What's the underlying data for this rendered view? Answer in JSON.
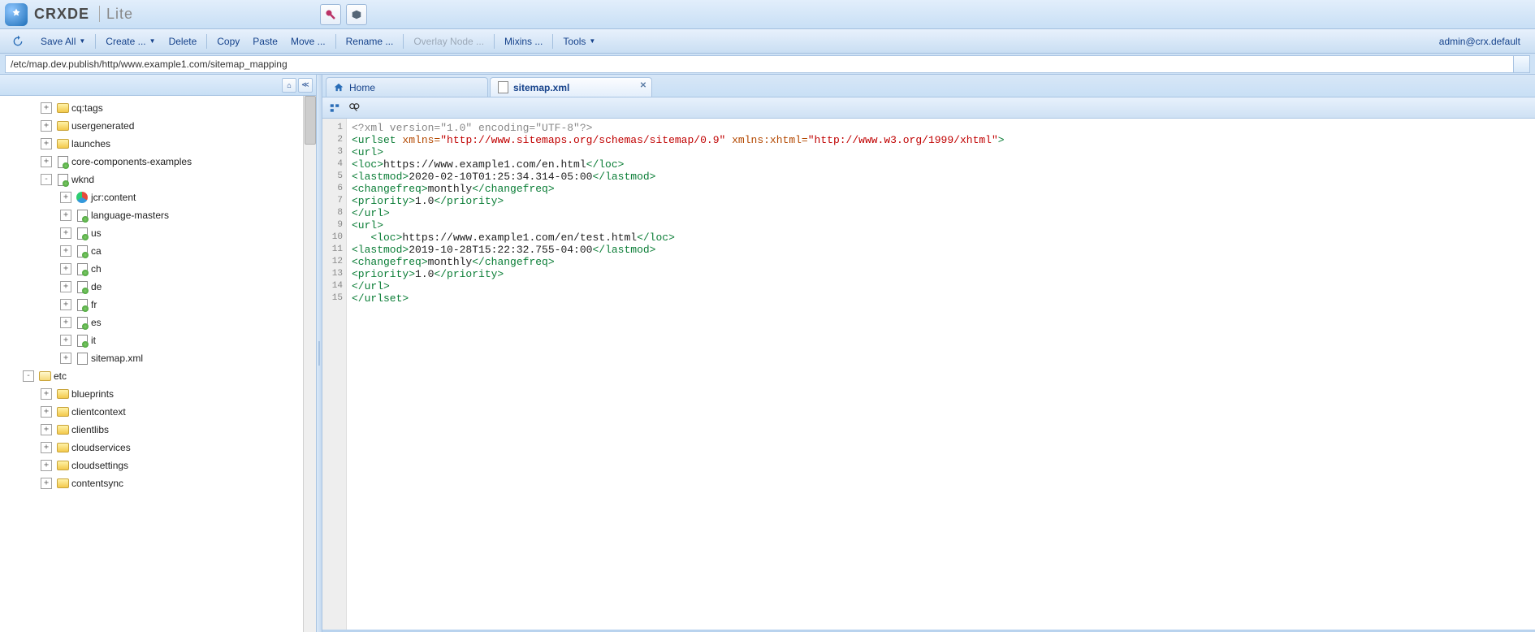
{
  "brand": {
    "name": "CRXDE",
    "suffix": "Lite"
  },
  "toolbar": {
    "save_all": "Save All",
    "create": "Create ...",
    "delete": "Delete",
    "copy": "Copy",
    "paste": "Paste",
    "move": "Move ...",
    "rename": "Rename ...",
    "overlay": "Overlay Node ...",
    "mixins": "Mixins ...",
    "tools": "Tools"
  },
  "user": "admin@crx.default",
  "path": "/etc/map.dev.publish/http/www.example1.com/sitemap_mapping",
  "tree": [
    {
      "indent": 48,
      "toggle": "+",
      "icon": "folder",
      "label": "cq:tags"
    },
    {
      "indent": 48,
      "toggle": "+",
      "icon": "folder",
      "label": "usergenerated"
    },
    {
      "indent": 48,
      "toggle": "+",
      "icon": "folder",
      "label": "launches"
    },
    {
      "indent": 48,
      "toggle": "+",
      "icon": "page",
      "label": "core-components-examples"
    },
    {
      "indent": 48,
      "toggle": "-",
      "icon": "page",
      "label": "wknd"
    },
    {
      "indent": 72,
      "toggle": "+",
      "icon": "jcr",
      "label": "jcr:content"
    },
    {
      "indent": 72,
      "toggle": "+",
      "icon": "page",
      "label": "language-masters"
    },
    {
      "indent": 72,
      "toggle": "+",
      "icon": "page",
      "label": "us"
    },
    {
      "indent": 72,
      "toggle": "+",
      "icon": "page",
      "label": "ca"
    },
    {
      "indent": 72,
      "toggle": "+",
      "icon": "page",
      "label": "ch"
    },
    {
      "indent": 72,
      "toggle": "+",
      "icon": "page",
      "label": "de"
    },
    {
      "indent": 72,
      "toggle": "+",
      "icon": "page",
      "label": "fr"
    },
    {
      "indent": 72,
      "toggle": "+",
      "icon": "page",
      "label": "es"
    },
    {
      "indent": 72,
      "toggle": "+",
      "icon": "page",
      "label": "it"
    },
    {
      "indent": 72,
      "toggle": "+",
      "icon": "file",
      "label": "sitemap.xml"
    },
    {
      "indent": 26,
      "toggle": "-",
      "icon": "folder-open",
      "label": "etc"
    },
    {
      "indent": 48,
      "toggle": "+",
      "icon": "folder",
      "label": "blueprints"
    },
    {
      "indent": 48,
      "toggle": "+",
      "icon": "folder",
      "label": "clientcontext"
    },
    {
      "indent": 48,
      "toggle": "+",
      "icon": "folder",
      "label": "clientlibs"
    },
    {
      "indent": 48,
      "toggle": "+",
      "icon": "folder",
      "label": "cloudservices"
    },
    {
      "indent": 48,
      "toggle": "+",
      "icon": "folder",
      "label": "cloudsettings"
    },
    {
      "indent": 48,
      "toggle": "+",
      "icon": "folder",
      "label": "contentsync"
    }
  ],
  "tabs": [
    {
      "label": "Home",
      "icon": "home",
      "closable": false,
      "active": false
    },
    {
      "label": "sitemap.xml",
      "icon": "file",
      "closable": true,
      "active": true
    }
  ],
  "editor": {
    "lines": [
      [
        {
          "t": "decl",
          "v": "<?xml version=\"1.0\" encoding=\"UTF-8\"?>"
        }
      ],
      [
        {
          "t": "tag",
          "v": "<urlset"
        },
        {
          "t": "txt",
          "v": " "
        },
        {
          "t": "attr",
          "v": "xmlns="
        },
        {
          "t": "str",
          "v": "\"http://www.sitemaps.org/schemas/sitemap/0.9\""
        },
        {
          "t": "txt",
          "v": " "
        },
        {
          "t": "attr",
          "v": "xmlns:xhtml="
        },
        {
          "t": "str",
          "v": "\"http://www.w3.org/1999/xhtml\""
        },
        {
          "t": "tag",
          "v": ">"
        }
      ],
      [
        {
          "t": "tag",
          "v": "<url>"
        }
      ],
      [
        {
          "t": "tag",
          "v": "<loc>"
        },
        {
          "t": "txt",
          "v": "https://www.example1.com/en.html"
        },
        {
          "t": "tag",
          "v": "</loc>"
        }
      ],
      [
        {
          "t": "tag",
          "v": "<lastmod>"
        },
        {
          "t": "txt",
          "v": "2020-02-10T01:25:34.314-05:00"
        },
        {
          "t": "tag",
          "v": "</lastmod>"
        }
      ],
      [
        {
          "t": "tag",
          "v": "<changefreq>"
        },
        {
          "t": "txt",
          "v": "monthly"
        },
        {
          "t": "tag",
          "v": "</changefreq>"
        }
      ],
      [
        {
          "t": "tag",
          "v": "<priority>"
        },
        {
          "t": "txt",
          "v": "1.0"
        },
        {
          "t": "tag",
          "v": "</priority>"
        }
      ],
      [
        {
          "t": "tag",
          "v": "</url>"
        }
      ],
      [
        {
          "t": "tag",
          "v": "<url>"
        }
      ],
      [
        {
          "t": "txt",
          "v": "   "
        },
        {
          "t": "tag",
          "v": "<loc>"
        },
        {
          "t": "txt",
          "v": "https://www.example1.com/en/test.html"
        },
        {
          "t": "tag",
          "v": "</loc>"
        }
      ],
      [
        {
          "t": "tag",
          "v": "<lastmod>"
        },
        {
          "t": "txt",
          "v": "2019-10-28T15:22:32.755-04:00"
        },
        {
          "t": "tag",
          "v": "</lastmod>"
        }
      ],
      [
        {
          "t": "tag",
          "v": "<changefreq>"
        },
        {
          "t": "txt",
          "v": "monthly"
        },
        {
          "t": "tag",
          "v": "</changefreq>"
        }
      ],
      [
        {
          "t": "tag",
          "v": "<priority>"
        },
        {
          "t": "txt",
          "v": "1.0"
        },
        {
          "t": "tag",
          "v": "</priority>"
        }
      ],
      [
        {
          "t": "tag",
          "v": "</url>"
        }
      ],
      [
        {
          "t": "tag",
          "v": "</urlset>"
        }
      ]
    ]
  }
}
